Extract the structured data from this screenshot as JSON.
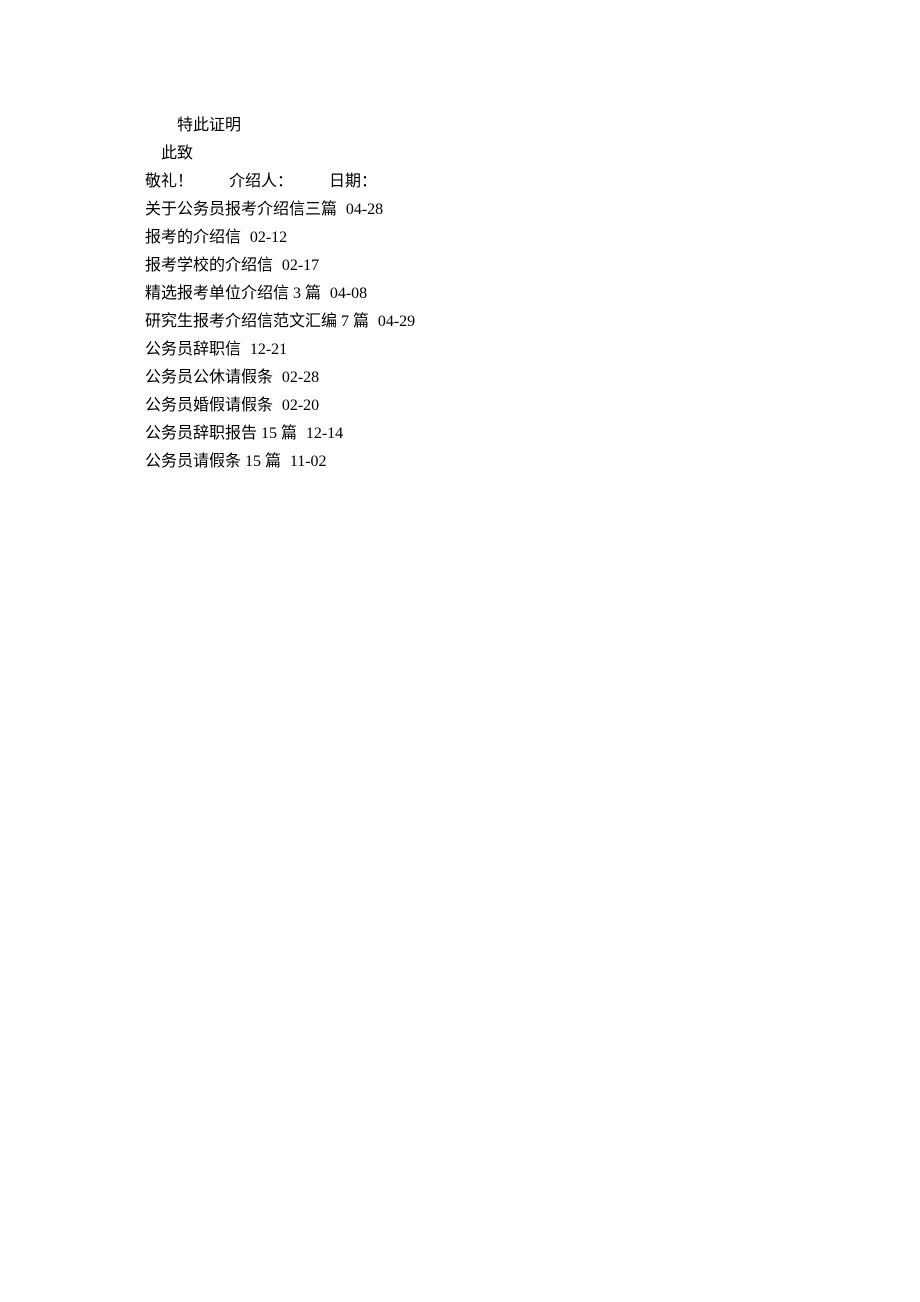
{
  "body": {
    "line1": "特此证明",
    "line2": "此致"
  },
  "signature": {
    "salute": "敬礼！",
    "introducer_label": "介绍人：",
    "date_label": "日期："
  },
  "links": [
    {
      "title": "关于公务员报考介绍信三篇",
      "date": "04-28"
    },
    {
      "title": "报考的介绍信",
      "date": "02-12"
    },
    {
      "title": "报考学校的介绍信",
      "date": "02-17"
    },
    {
      "title": "精选报考单位介绍信 3 篇",
      "date": "04-08"
    },
    {
      "title": "研究生报考介绍信范文汇编 7 篇",
      "date": "04-29"
    },
    {
      "title": "公务员辞职信",
      "date": "12-21"
    },
    {
      "title": "公务员公休请假条",
      "date": "02-28"
    },
    {
      "title": "公务员婚假请假条",
      "date": "02-20"
    },
    {
      "title": "公务员辞职报告 15 篇",
      "date": "12-14"
    },
    {
      "title": "公务员请假条 15 篇",
      "date": "11-02"
    }
  ]
}
